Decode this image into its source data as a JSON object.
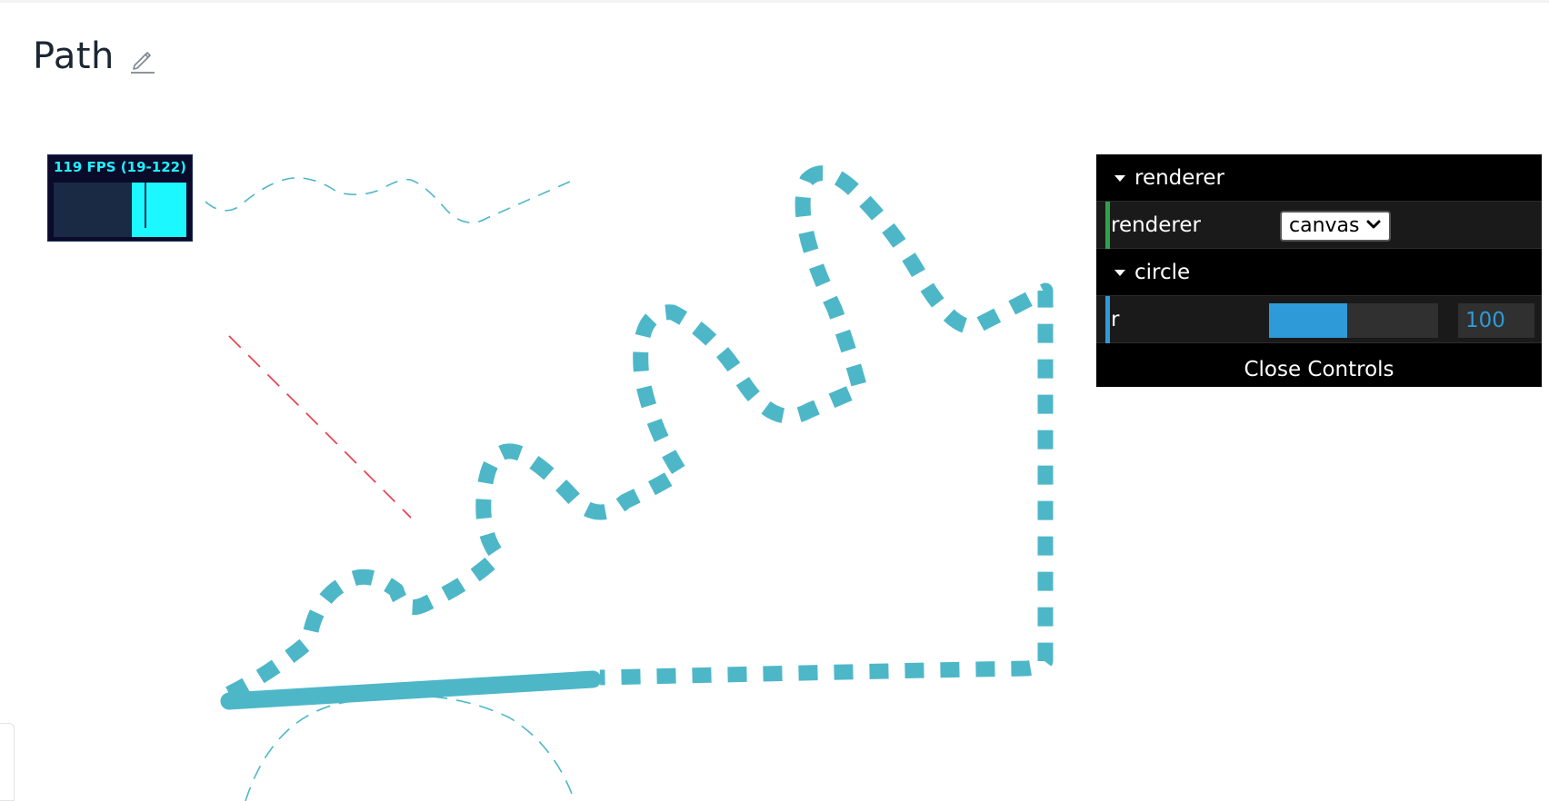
{
  "page": {
    "title": "Path",
    "edit_icon": "pencil-icon"
  },
  "stats": {
    "fps_label": "119 FPS (19-122)",
    "fps": 119,
    "fps_min": 19,
    "fps_max": 122
  },
  "controls": {
    "folders": [
      {
        "title": "renderer"
      },
      {
        "title": "circle"
      }
    ],
    "renderer": {
      "label": "renderer",
      "selected": "canvas",
      "accent": "#2fa14b"
    },
    "circle": {
      "label": "r",
      "value": "100",
      "slider_fraction": 0.46,
      "accent": "#2f9ad8"
    },
    "close_label": "Close Controls"
  },
  "colors": {
    "stroke": "#4db7c8",
    "red_dash": "#ee3344",
    "stats_text": "#1ff0ff",
    "slider": "#2f9ad8"
  }
}
